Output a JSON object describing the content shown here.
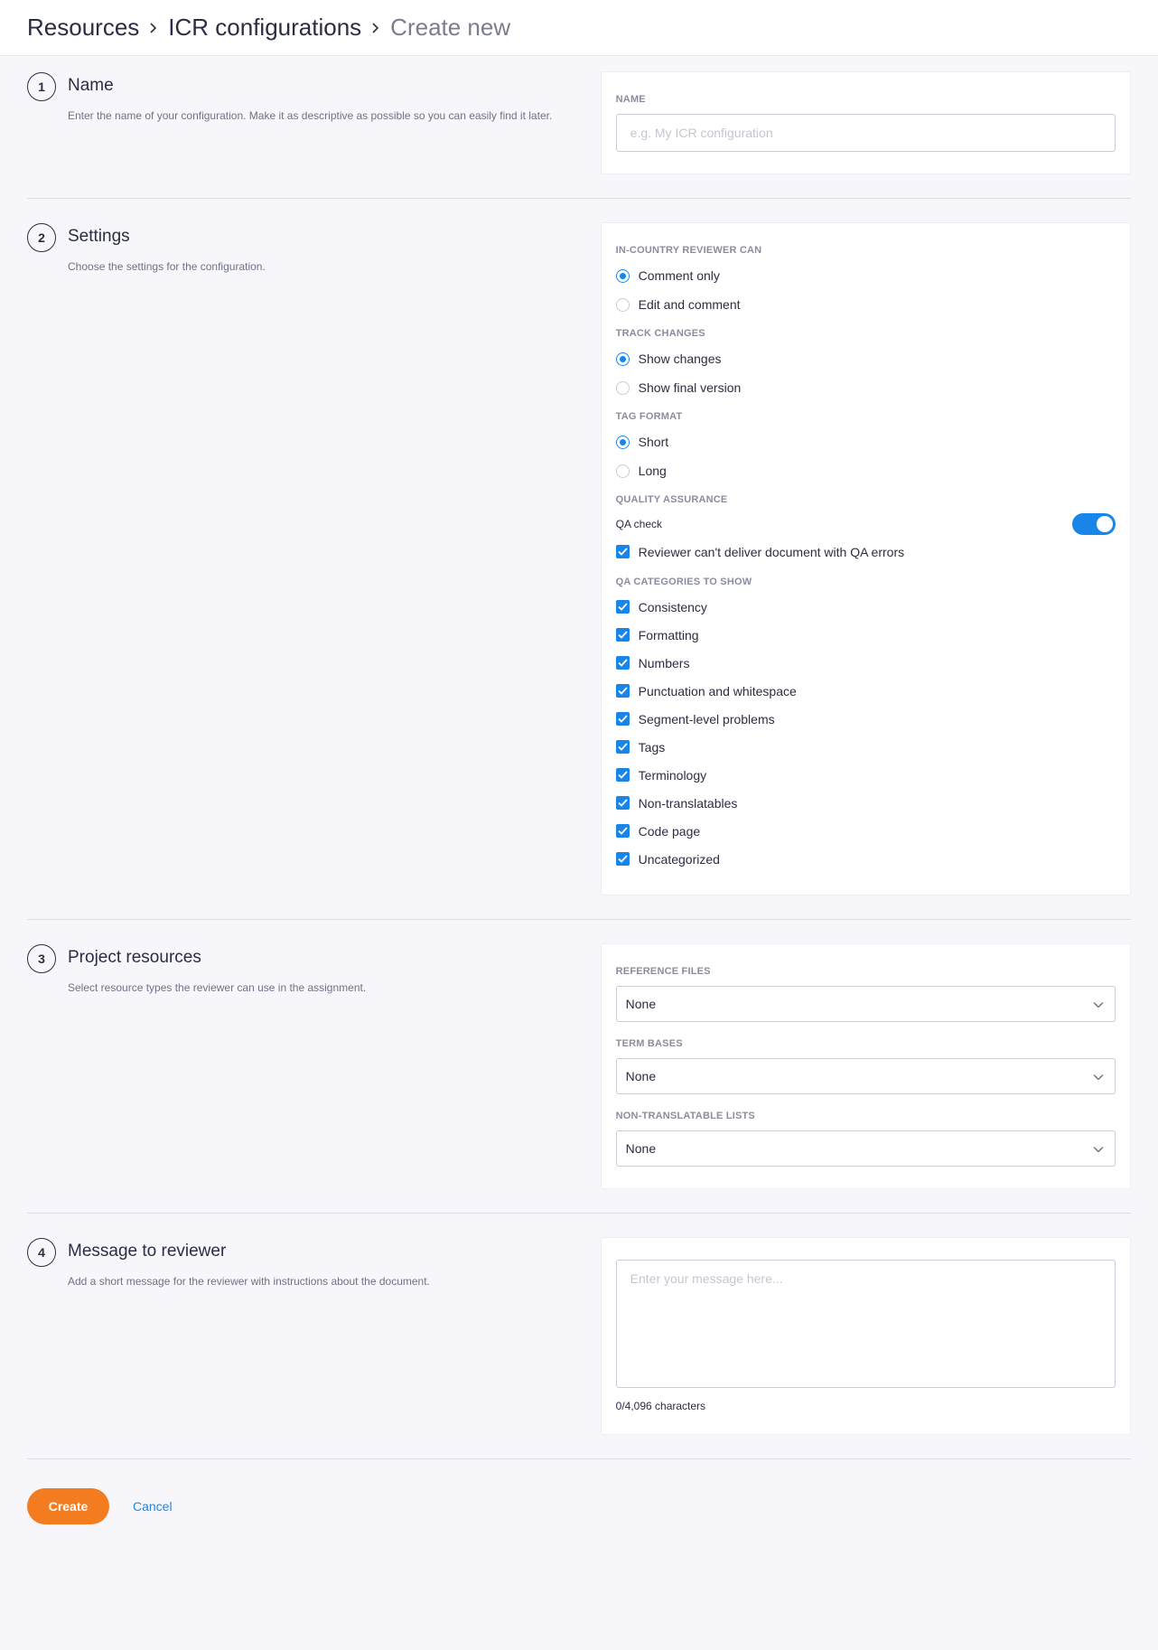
{
  "breadcrumb": {
    "items": [
      "Resources",
      "ICR configurations"
    ],
    "current": "Create new"
  },
  "sections": {
    "name": {
      "step": "1",
      "title": "Name",
      "description": "Enter the name of your configuration. Make it as descriptive as possible so you can easily find it later.",
      "field_label": "NAME",
      "placeholder": "e.g. My ICR configuration",
      "value": ""
    },
    "settings": {
      "step": "2",
      "title": "Settings",
      "description": "Choose the settings for the configuration.",
      "reviewer_can": {
        "label": "IN-COUNTRY REVIEWER CAN",
        "options": [
          "Comment only",
          "Edit and comment"
        ],
        "selected": "Comment only"
      },
      "track_changes": {
        "label": "TRACK CHANGES",
        "options": [
          "Show changes",
          "Show final version"
        ],
        "selected": "Show changes"
      },
      "tag_format": {
        "label": "TAG FORMAT",
        "options": [
          "Short",
          "Long"
        ],
        "selected": "Short"
      },
      "quality_assurance": {
        "label": "QUALITY ASSURANCE",
        "qa_check_label": "QA check",
        "qa_check_enabled": true,
        "deliver_block_label": "Reviewer can't deliver document with QA errors",
        "deliver_block_checked": true
      },
      "qa_categories": {
        "label": "QA CATEGORIES TO SHOW",
        "items": [
          "Consistency",
          "Formatting",
          "Numbers",
          "Punctuation and whitespace",
          "Segment-level problems",
          "Tags",
          "Terminology",
          "Non-translatables",
          "Code page",
          "Uncategorized"
        ]
      }
    },
    "resources": {
      "step": "3",
      "title": "Project resources",
      "description": "Select resource types the reviewer can use in the assignment.",
      "reference_files": {
        "label": "REFERENCE FILES",
        "value": "None"
      },
      "term_bases": {
        "label": "TERM BASES",
        "value": "None"
      },
      "non_translatable_lists": {
        "label": "NON-TRANSLATABLE LISTS",
        "value": "None"
      }
    },
    "message": {
      "step": "4",
      "title": "Message to reviewer",
      "description": "Add a short message for the reviewer with instructions about the document.",
      "placeholder": "Enter your message here...",
      "char_count": "0/4,096 characters"
    }
  },
  "footer": {
    "create_label": "Create",
    "cancel_label": "Cancel"
  },
  "colors": {
    "accent_blue": "#1a85e8",
    "create_orange": "#f47c20",
    "background": "#f7f7fb"
  },
  "icons": {
    "breadcrumb_separator": "chevron-right-icon",
    "select_arrow": "chevron-down-icon",
    "check": "check-icon"
  }
}
